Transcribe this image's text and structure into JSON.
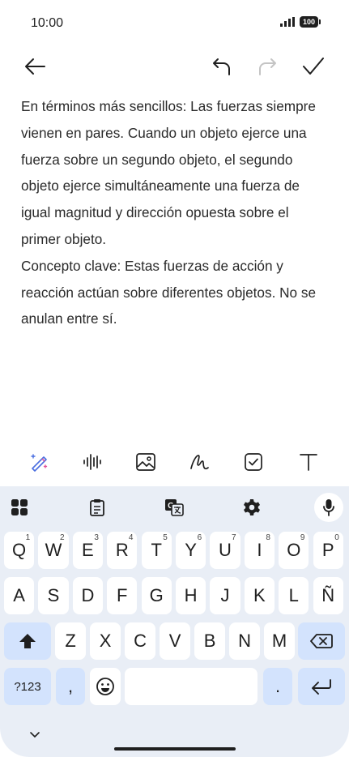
{
  "status": {
    "time": "10:00",
    "battery": "100"
  },
  "toolbar": {
    "back_icon": "arrow-left-icon",
    "undo_icon": "undo-icon",
    "redo_icon": "redo-icon",
    "done_icon": "check-icon"
  },
  "note": {
    "text": "En términos más sencillos: Las fuerzas siempre vienen en pares. Cuando un objeto ejerce una fuerza sobre un segundo objeto, el segundo objeto ejerce simultáneamente una fuerza de igual magnitud y dirección opuesta sobre el primer objeto.\nConcepto clave: Estas fuerzas de acción y reacción actúan sobre diferentes objetos. No se anulan entre sí."
  },
  "format_bar": {
    "icons": [
      "magic-pen-icon",
      "voice-waveform-icon",
      "image-icon",
      "handwriting-icon",
      "checkbox-icon",
      "text-format-icon"
    ]
  },
  "keyboard": {
    "tools": [
      "apps-grid-icon",
      "clipboard-icon",
      "translate-icon",
      "settings-icon",
      "microphone-icon"
    ],
    "row1": [
      {
        "label": "Q",
        "sup": "1"
      },
      {
        "label": "W",
        "sup": "2"
      },
      {
        "label": "E",
        "sup": "3"
      },
      {
        "label": "R",
        "sup": "4"
      },
      {
        "label": "T",
        "sup": "5"
      },
      {
        "label": "Y",
        "sup": "6"
      },
      {
        "label": "U",
        "sup": "7"
      },
      {
        "label": "I",
        "sup": "8"
      },
      {
        "label": "O",
        "sup": "9"
      },
      {
        "label": "P",
        "sup": "0"
      }
    ],
    "row2": [
      "A",
      "S",
      "D",
      "F",
      "G",
      "H",
      "J",
      "K",
      "L",
      "Ñ"
    ],
    "row3": [
      "Z",
      "X",
      "C",
      "V",
      "B",
      "N",
      "M"
    ],
    "symbols_label": "?123",
    "comma_label": ",",
    "period_label": ".",
    "space_label": ""
  }
}
